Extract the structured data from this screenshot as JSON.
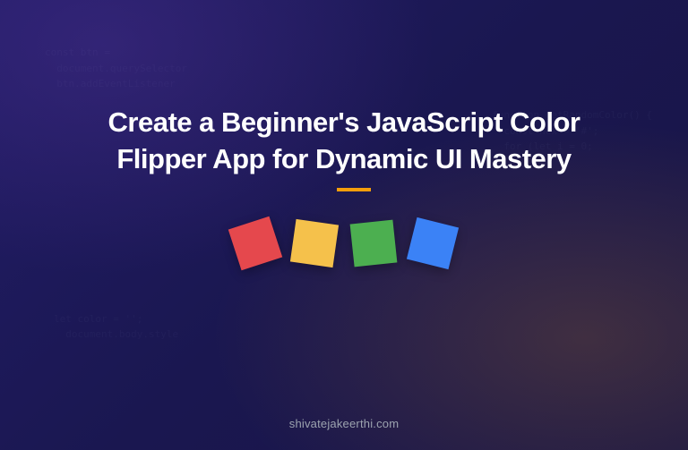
{
  "title": "Create a Beginner's JavaScript Color Flipper App for Dynamic UI Mastery",
  "footer": "shivatejakeerthi.com",
  "swatches": [
    {
      "color": "#e5484d",
      "name": "red"
    },
    {
      "color": "#f5c14b",
      "name": "yellow"
    },
    {
      "color": "#4caf50",
      "name": "green"
    },
    {
      "color": "#3b82f6",
      "name": "blue"
    }
  ],
  "colors": {
    "accent": "#f59e0b",
    "background_primary": "#1e1a5e"
  }
}
